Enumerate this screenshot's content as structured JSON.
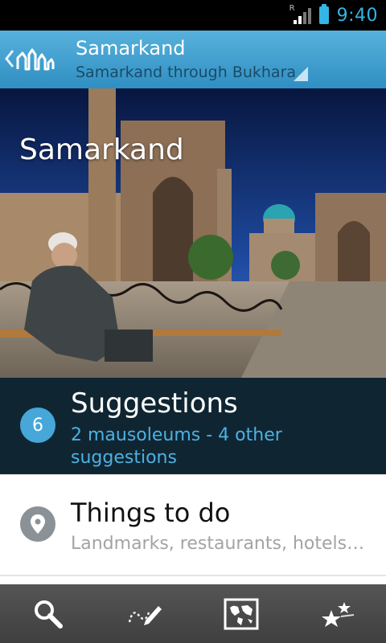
{
  "status_bar": {
    "time": "9:40",
    "signal_roaming_label": "R",
    "icons": [
      "signal-icon",
      "battery-icon"
    ]
  },
  "header": {
    "title": "Samarkand",
    "subtitle": "Samarkand through Bukhara",
    "icons": [
      "back-chevron-icon",
      "app-logo-icon",
      "dropdown-triangle-icon"
    ]
  },
  "hero": {
    "title": "Samarkand"
  },
  "suggestions": {
    "count": "6",
    "title": "Suggestions",
    "subtitle": "2 mausoleums - 4 other suggestions"
  },
  "things_to_do": {
    "title": "Things to do",
    "subtitle": "Landmarks, restaurants, hotels ...",
    "icon": "location-pin-icon"
  },
  "bottom_tabs": [
    {
      "icon": "search-icon"
    },
    {
      "icon": "pencil-note-icon"
    },
    {
      "icon": "world-map-icon"
    },
    {
      "icon": "stars-icon"
    }
  ],
  "colors": {
    "accent": "#33b5e5",
    "header_blue": "#3d9ccb",
    "suggestions_bg": "#0f2632",
    "badge_blue": "#46a7d8",
    "bottom_bar": "#4b4b4b"
  }
}
